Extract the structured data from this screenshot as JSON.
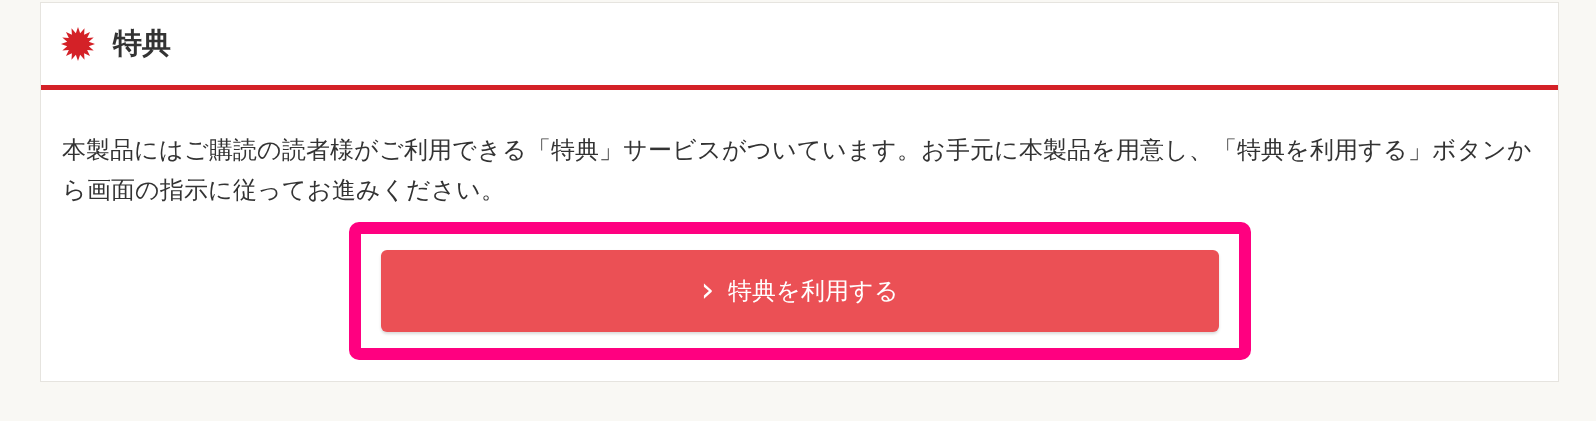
{
  "section": {
    "title": "特典"
  },
  "description": "本製品にはご購読の読者様がご利用できる「特典」サービスがついています。お手元に本製品を用意し、「特典を利用する」ボタンから画面の指示に従ってお進みください。",
  "button": {
    "icon": "›",
    "label": "特典を利用する"
  }
}
